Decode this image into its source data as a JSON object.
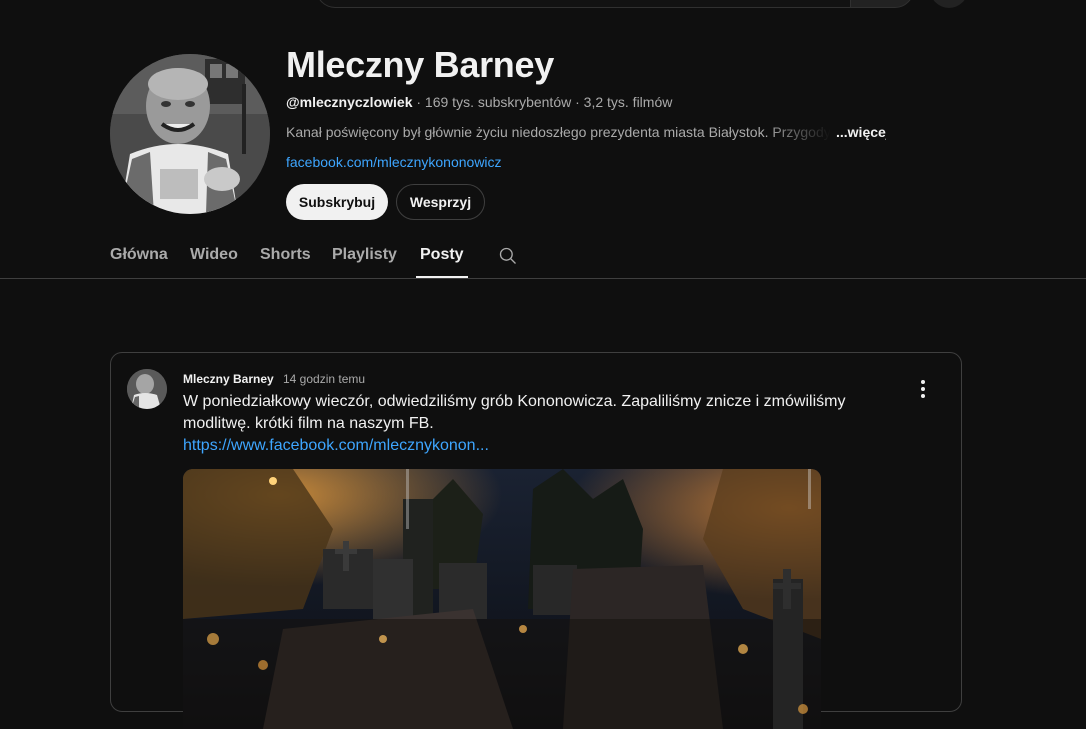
{
  "channel": {
    "name": "Mleczny Barney",
    "handle": "@mlecznyczlowiek",
    "stats": " · 169 tys. subskrybentów · 3,2 tys. filmów",
    "description": "Kanał poświęcony był głównie życiu niedoszłego prezydenta miasta Białystok. Przygody",
    "more_label": "...więcej",
    "link": "facebook.com/mlecznykononowicz",
    "subscribe_label": "Subskrybuj",
    "support_label": "Wesprzyj"
  },
  "tabs": [
    {
      "label": "Główna",
      "active": false
    },
    {
      "label": "Wideo",
      "active": false
    },
    {
      "label": "Shorts",
      "active": false
    },
    {
      "label": "Playlisty",
      "active": false
    },
    {
      "label": "Posty",
      "active": true
    }
  ],
  "post": {
    "author": "Mleczny Barney",
    "time": "14 godzin temu",
    "text": "W poniedziałkowy wieczór, odwiedziliśmy grób Kononowicza. Zapaliliśmy znicze i zmówiliśmy modlitwę. krótki film na naszym FB.",
    "link": "https://www.facebook.com/mlecznykonon..."
  },
  "colors": {
    "background": "#0f0f0f",
    "link": "#3ea6ff",
    "text": "#f1f1f1",
    "muted": "#aaaaaa"
  },
  "icons": {
    "search": "search-icon",
    "more": "more-vert-icon"
  }
}
